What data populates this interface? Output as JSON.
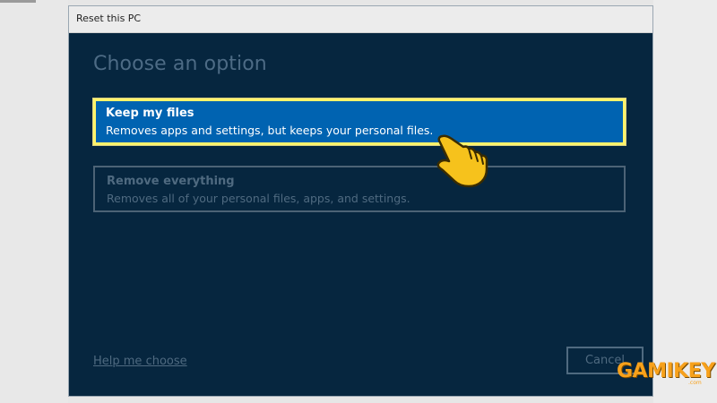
{
  "window": {
    "title": "Reset this PC"
  },
  "main": {
    "heading": "Choose an option",
    "options": [
      {
        "label": "Keep my files",
        "description": "Removes apps and settings, but keeps your personal files.",
        "selected": true
      },
      {
        "label": "Remove everything",
        "description": "Removes all of your personal files, apps, and settings.",
        "selected": false
      }
    ]
  },
  "footer": {
    "help_link": "Help me choose",
    "cancel_label": "Cancel"
  },
  "overlay": {
    "pointer_icon": "hand-pointer-icon",
    "watermark": "GAMIKEY",
    "watermark_small": ".com"
  },
  "colors": {
    "dialog_bg": "#06263f",
    "selected_bg": "#0063b1",
    "selected_border": "#fff36b",
    "muted_text": "#4f6a80",
    "pointer_fill": "#f6c21c",
    "watermark": "#f7a11b"
  }
}
